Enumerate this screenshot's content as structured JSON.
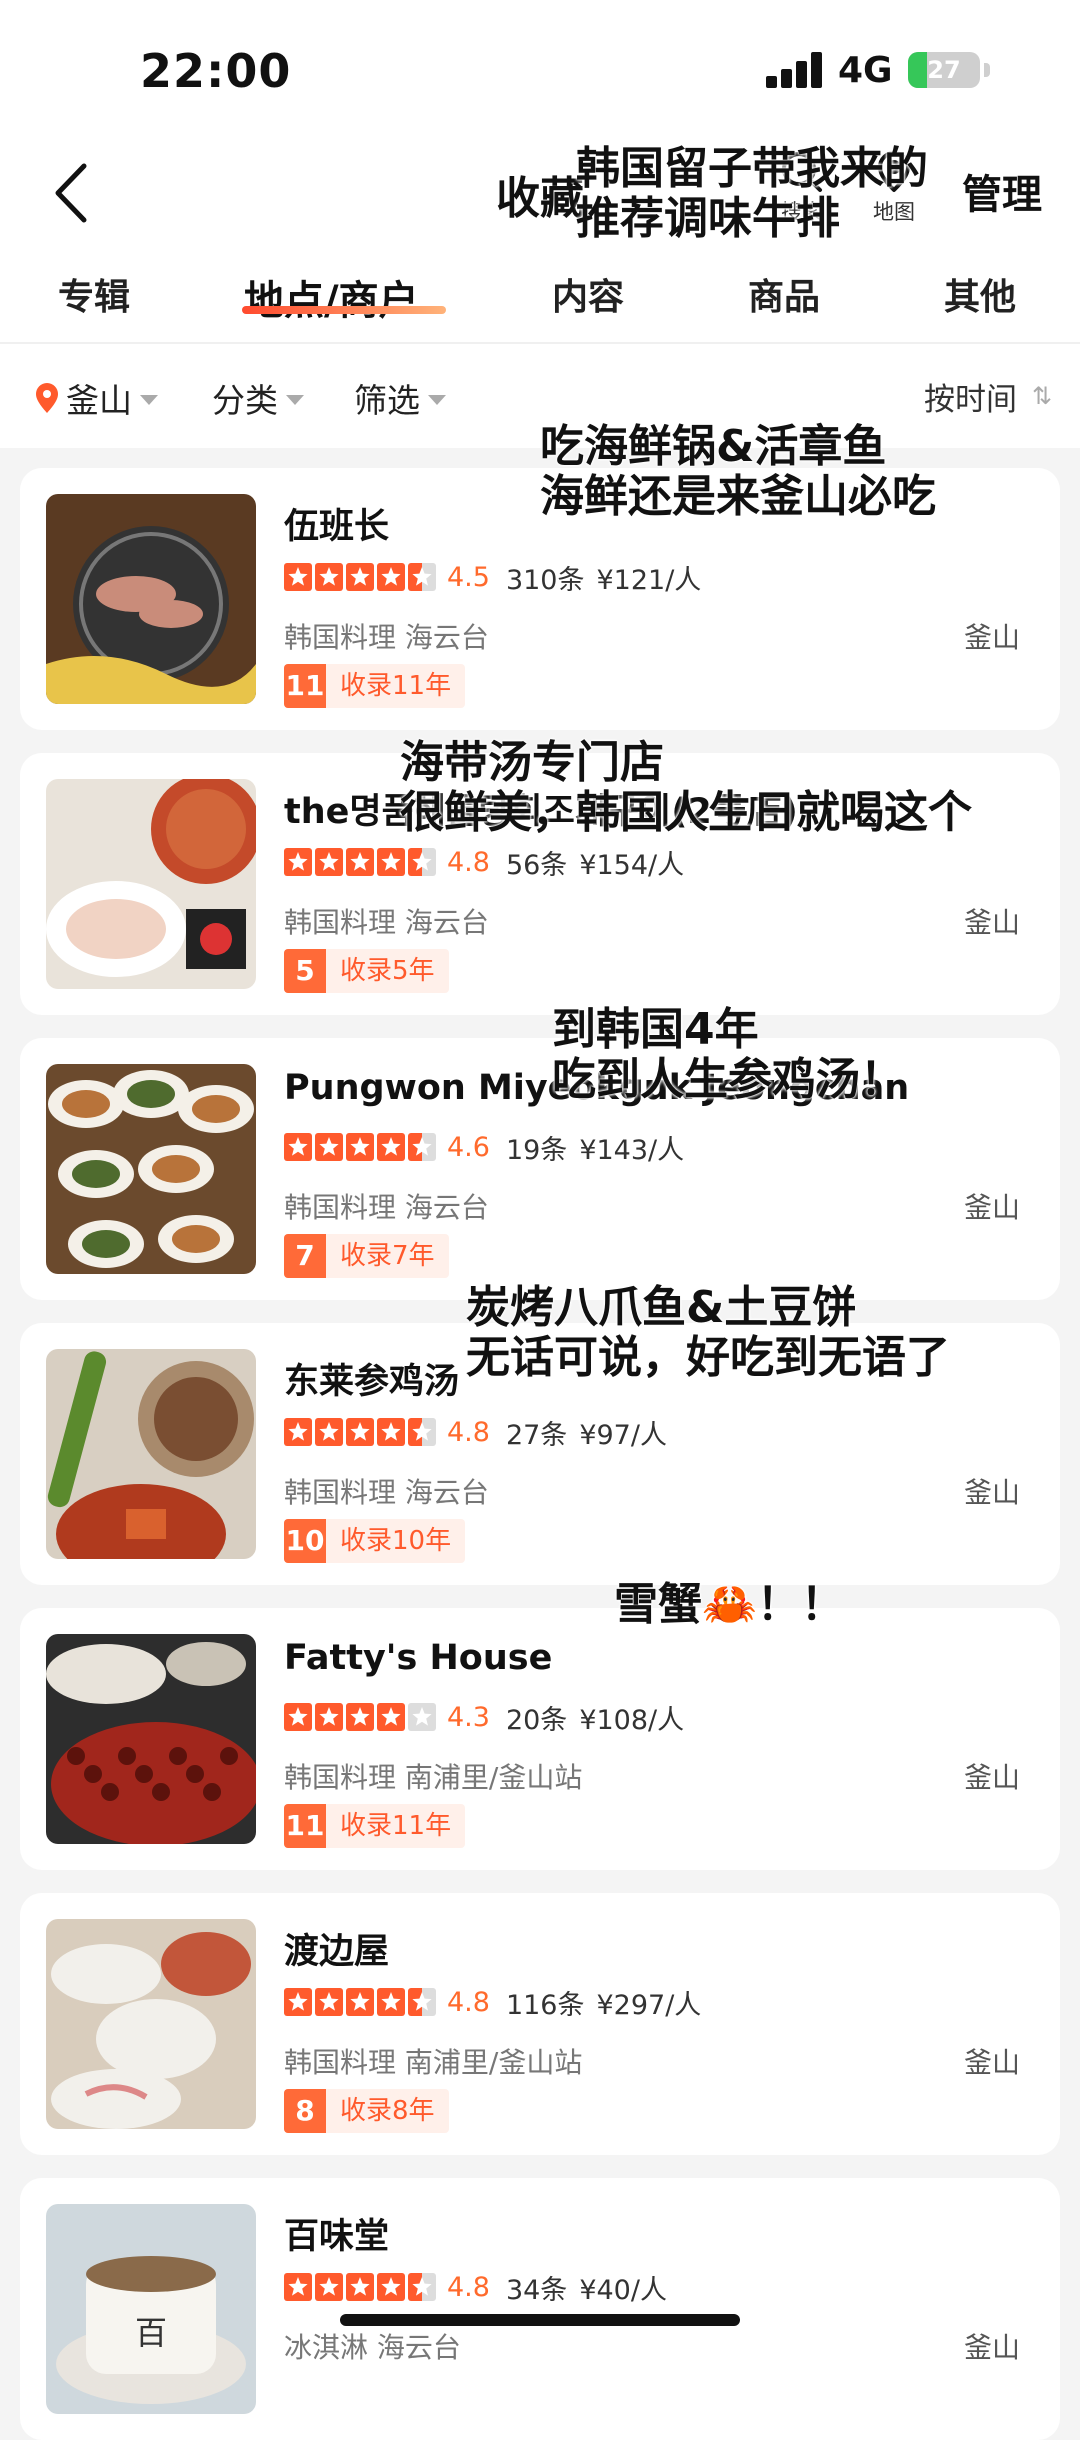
{
  "status_bar": {
    "time": "22:00",
    "network": "4G",
    "battery": "27",
    "battery_level": 0.27
  },
  "nav": {
    "title": "收藏",
    "search_label": "搜索",
    "map_label": "地图",
    "manage_label": "管理"
  },
  "tabs": [
    {
      "label": "专辑",
      "active": false
    },
    {
      "label": "地点/商户",
      "active": true
    },
    {
      "label": "内容",
      "active": false
    },
    {
      "label": "商品",
      "active": false
    },
    {
      "label": "其他",
      "active": false
    }
  ],
  "filters": {
    "city": "釜山",
    "category": "分类",
    "filter": "筛选",
    "sort": "按时间"
  },
  "items": [
    {
      "name": "伍班长",
      "rating": 4.5,
      "score": "4.5",
      "reviews": "310条",
      "price": "¥121/人",
      "category": "韩国料理",
      "area": "海云台",
      "city": "釜山",
      "badge_num": "11",
      "badge_text": "收录11年",
      "note": [
        "韩国留子带我来的",
        "推荐调味牛排"
      ]
    },
    {
      "name": "the명품해물탕회조개구이(2号店)",
      "rating": 4.8,
      "score": "4.8",
      "reviews": "56条",
      "price": "¥154/人",
      "category": "韩国料理",
      "area": "海云台",
      "city": "釜山",
      "badge_num": "5",
      "badge_text": "收录5年",
      "note": [
        "吃海鲜锅&活章鱼",
        "海鲜还是来釜山必吃"
      ]
    },
    {
      "name": "Pungwon Miyeokguk Jeongchan",
      "rating": 4.6,
      "score": "4.6",
      "reviews": "19条",
      "price": "¥143/人",
      "category": "韩国料理",
      "area": "海云台",
      "city": "釜山",
      "badge_num": "7",
      "badge_text": "收录7年",
      "note": [
        "海带汤专门店",
        "很鲜美，韩国人生日就喝这个"
      ]
    },
    {
      "name": "东莱参鸡汤",
      "rating": 4.8,
      "score": "4.8",
      "reviews": "27条",
      "price": "¥97/人",
      "category": "韩国料理",
      "area": "海云台",
      "city": "釜山",
      "badge_num": "10",
      "badge_text": "收录10年",
      "note": [
        "到韩国4年",
        "吃到人生参鸡汤！"
      ]
    },
    {
      "name": "Fatty's House",
      "rating": 4.3,
      "score": "4.3",
      "reviews": "20条",
      "price": "¥108/人",
      "category": "韩国料理",
      "area": "南浦里/釜山站",
      "city": "釜山",
      "badge_num": "11",
      "badge_text": "收录11年",
      "note": [
        "炭烤八爪鱼&土豆饼",
        "无话可说，好吃到无语了"
      ]
    },
    {
      "name": "渡边屋",
      "rating": 4.8,
      "score": "4.8",
      "reviews": "116条",
      "price": "¥297/人",
      "category": "韩国料理",
      "area": "南浦里/釜山站",
      "city": "釜山",
      "badge_num": "8",
      "badge_text": "收录8年",
      "note": [
        "雪蟹🦀！！"
      ]
    },
    {
      "name": "百味堂",
      "rating": 4.8,
      "score": "4.8",
      "reviews": "34条",
      "price": "¥40/人",
      "category": "冰淇淋",
      "area": "海云台",
      "city": "釜山",
      "badge_num": "",
      "badge_text": "",
      "note": []
    }
  ],
  "thumbs": [
    {
      "icon": "bbq-grill-photo",
      "bg": "#5a3a22",
      "accent": "#c98c7a",
      "accent2": "#e8c44a"
    },
    {
      "icon": "seafood-platter-photo",
      "bg": "#e9e3da",
      "accent": "#d2663a",
      "accent2": "#f0e6d2"
    },
    {
      "icon": "banchan-dishes-photo",
      "bg": "#6b4a2d",
      "accent": "#f4f0e8",
      "accent2": "#4f6b2e"
    },
    {
      "icon": "samgyetang-photo",
      "bg": "#d8cfc2",
      "accent": "#5b8a2d",
      "accent2": "#d9612e"
    },
    {
      "icon": "grilled-octopus-photo",
      "bg": "#2d2d2d",
      "accent": "#a1261c",
      "accent2": "#e8e3da"
    },
    {
      "icon": "snow-crab-photo",
      "bg": "#d9cdbd",
      "accent": "#f2f0eb",
      "accent2": "#c2563a"
    },
    {
      "icon": "latte-cup-photo",
      "bg": "#cfd8dd",
      "accent": "#f7f5f0",
      "accent2": "#8a6a4a"
    }
  ]
}
